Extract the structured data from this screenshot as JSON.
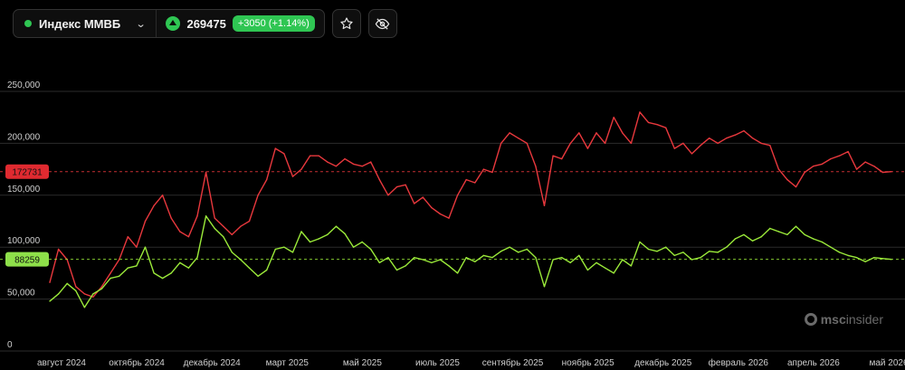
{
  "toolbar": {
    "symbol_name": "Индекс ММВБ",
    "price": "269475",
    "change": "+3050 (+1.14%)",
    "status_color": "#2fc653",
    "favorite_icon": "star-icon",
    "hide_icon": "eye-off-icon"
  },
  "brand": {
    "prefix": "msc",
    "suffix": "insider"
  },
  "chart_data": {
    "type": "line",
    "ylim": [
      0,
      290000
    ],
    "y_ticks": [
      "0",
      "50,000",
      "100,000",
      "150,000",
      "200,000",
      "250,000"
    ],
    "x_ticks": [
      "август 2024",
      "октябрь 2024",
      "декабрь 2024",
      "март 2025",
      "май 2025",
      "июль 2025",
      "сентябрь 2025",
      "ноябрь 2025",
      "декабрь 2025",
      "февраль 2026",
      "апрель 2026",
      "май 2026"
    ],
    "grid": true,
    "series": [
      {
        "color": "#e8383d",
        "last_value": "172731",
        "values": [
          66000,
          98000,
          88000,
          62000,
          55000,
          52000,
          62000,
          75000,
          88000,
          110000,
          100000,
          125000,
          140000,
          150000,
          128000,
          115000,
          110000,
          130000,
          172000,
          128000,
          120000,
          112000,
          120000,
          125000,
          150000,
          165000,
          195000,
          190000,
          168000,
          175000,
          188000,
          188000,
          182000,
          178000,
          185000,
          180000,
          178000,
          182000,
          165000,
          150000,
          158000,
          160000,
          142000,
          148000,
          138000,
          132000,
          128000,
          150000,
          165000,
          162000,
          175000,
          172000,
          200000,
          210000,
          205000,
          200000,
          178000,
          140000,
          188000,
          185000,
          200000,
          210000,
          195000,
          210000,
          200000,
          225000,
          210000,
          200000,
          230000,
          220000,
          218000,
          215000,
          195000,
          200000,
          190000,
          198000,
          205000,
          200000,
          205000,
          208000,
          212000,
          205000,
          200000,
          198000,
          175000,
          165000,
          158000,
          172000,
          178000,
          180000,
          185000,
          188000,
          192000,
          175000,
          182000,
          178000,
          172000,
          172731
        ]
      },
      {
        "color": "#9bea3a",
        "last_value": "88259",
        "values": [
          48000,
          55000,
          65000,
          58000,
          42000,
          55000,
          60000,
          70000,
          72000,
          80000,
          82000,
          100000,
          75000,
          70000,
          75000,
          85000,
          80000,
          90000,
          130000,
          118000,
          110000,
          95000,
          88000,
          80000,
          72000,
          78000,
          98000,
          100000,
          95000,
          115000,
          105000,
          108000,
          112000,
          120000,
          113000,
          100000,
          105000,
          98000,
          85000,
          90000,
          78000,
          82000,
          90000,
          88000,
          85000,
          88000,
          82000,
          75000,
          90000,
          86000,
          92000,
          90000,
          96000,
          100000,
          95000,
          98000,
          90000,
          62000,
          88000,
          90000,
          85000,
          92000,
          78000,
          85000,
          80000,
          75000,
          88000,
          82000,
          105000,
          98000,
          96000,
          100000,
          92000,
          95000,
          88000,
          90000,
          96000,
          95000,
          100000,
          108000,
          112000,
          106000,
          110000,
          118000,
          115000,
          112000,
          120000,
          112000,
          108000,
          105000,
          100000,
          95000,
          92000,
          90000,
          86000,
          90000,
          89000,
          88259
        ]
      }
    ]
  }
}
